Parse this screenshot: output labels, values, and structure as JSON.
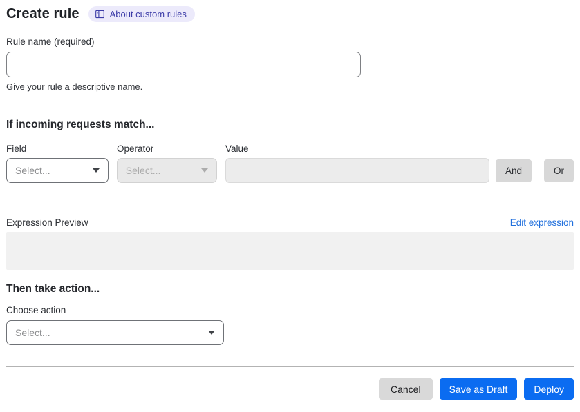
{
  "header": {
    "title": "Create rule",
    "about_badge_label": "About custom rules"
  },
  "rule_name": {
    "label": "Rule name (required)",
    "value": "",
    "help": "Give your rule a descriptive name."
  },
  "match_section": {
    "heading": "If incoming requests match...",
    "field": {
      "label": "Field",
      "selected": "Select..."
    },
    "operator": {
      "label": "Operator",
      "selected": "Select..."
    },
    "value": {
      "label": "Value",
      "value": "",
      "placeholder": ""
    },
    "and_button": "And",
    "or_button": "Or"
  },
  "expression": {
    "label": "Expression Preview",
    "edit_link": "Edit expression",
    "preview_content": ""
  },
  "action_section": {
    "heading": "Then take action...",
    "choose_label": "Choose action",
    "selected": "Select..."
  },
  "footer": {
    "cancel": "Cancel",
    "save_draft": "Save as Draft",
    "deploy": "Deploy"
  },
  "icons": {
    "about_badge": "book-icon",
    "selects": "caret-down-icon"
  },
  "colors": {
    "primary_blue": "#0b6cf1",
    "link_blue": "#2170dd",
    "badge_bg": "#eceafb",
    "badge_text": "#3c3ca8",
    "gray_button": "#d8d8d8",
    "disabled_bg": "#ececec",
    "preview_bg": "#f1f1f1",
    "divider": "#b3b3b3"
  }
}
